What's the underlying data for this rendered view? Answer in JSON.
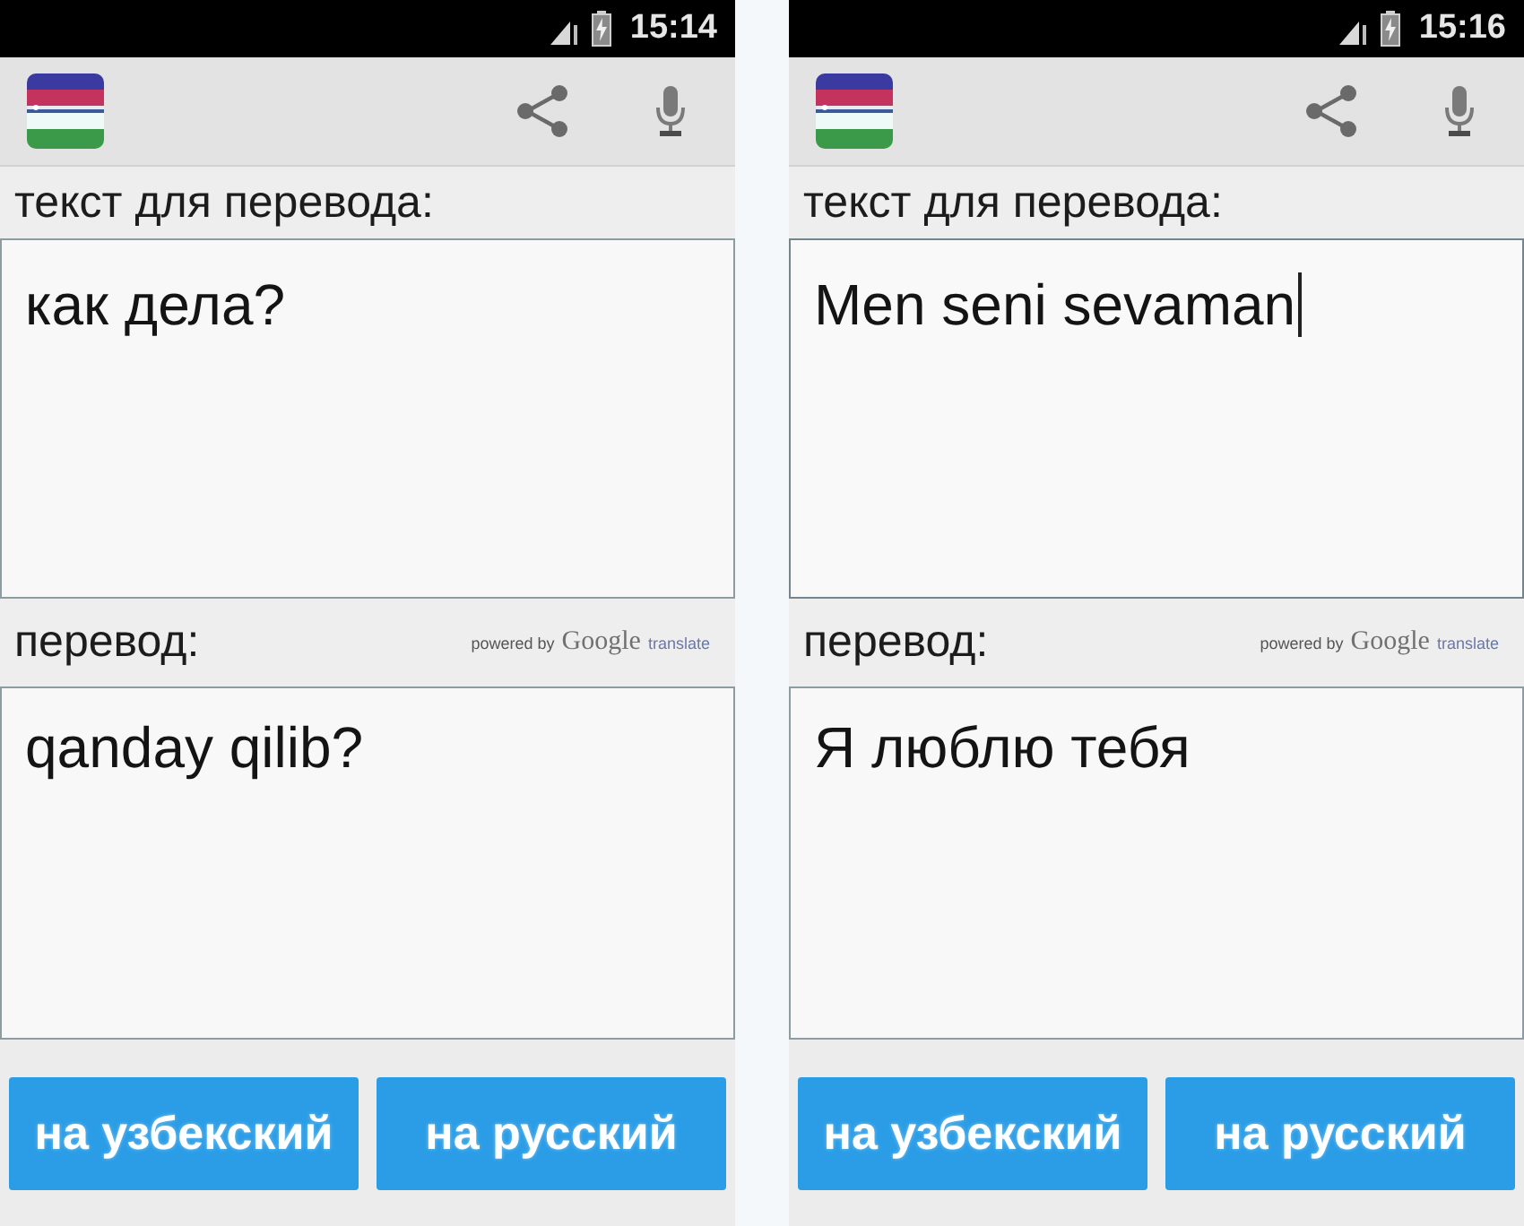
{
  "phones": [
    {
      "status_bar": {
        "time": "15:14"
      },
      "input": {
        "label": "текст для перевода:",
        "value": "как дела?",
        "focused": false
      },
      "output": {
        "label": "перевод:",
        "attribution": {
          "prefix": "powered by",
          "brand": "Google",
          "suffix": "translate"
        },
        "value": "qanday qilib?"
      },
      "buttons": [
        {
          "label": "на узбекский"
        },
        {
          "label": "на русский"
        }
      ]
    },
    {
      "status_bar": {
        "time": "15:16"
      },
      "input": {
        "label": "текст для перевода:",
        "value": "Men seni sevaman",
        "focused": true
      },
      "output": {
        "label": "перевод:",
        "attribution": {
          "prefix": "powered by",
          "brand": "Google",
          "suffix": "translate"
        },
        "value": "Я люблю тебя"
      },
      "buttons": [
        {
          "label": "на узбекский"
        },
        {
          "label": "на русский"
        }
      ]
    }
  ]
}
